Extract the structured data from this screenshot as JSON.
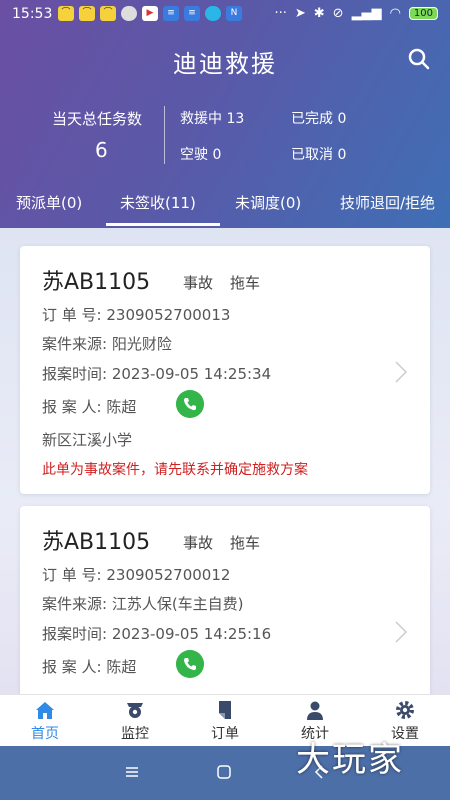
{
  "status_bar": {
    "time": "15:53",
    "battery": "100",
    "icons": [
      "notification-icons",
      "more-dots",
      "location-icon",
      "bluetooth-icon",
      "mute-icon",
      "signal-icon",
      "wifi-icon",
      "battery-icon"
    ]
  },
  "app": {
    "title": "迪迪救援"
  },
  "stats": {
    "total_label": "当天总任务数",
    "total_value": "6",
    "rescuing": "救援中 13",
    "completed": "已完成 0",
    "empty_driving": "空驶 0",
    "cancelled": "已取消 0"
  },
  "tabs": [
    {
      "label": "预派单(0)"
    },
    {
      "label": "未签收(11)",
      "active": true
    },
    {
      "label": "未调度(0)"
    },
    {
      "label": "技师退回/拒绝"
    }
  ],
  "orders": [
    {
      "plate": "苏AB1105",
      "type": "事故",
      "service": "拖车",
      "order_no": "订 单 号: 2309052700013",
      "source": "案件来源: 阳光财险",
      "report_time": "报案时间: 2023-09-05 14:25:34",
      "reporter": "报 案 人: 陈超",
      "address": "新区江溪小学",
      "warning": "此单为事故案件，请先联系并确定施救方案"
    },
    {
      "plate": "苏AB1105",
      "type": "事故",
      "service": "拖车",
      "order_no": "订 单 号: 2309052700012",
      "source": "案件来源: 江苏人保(车主自费)",
      "report_time": "报案时间: 2023-09-05 14:25:16",
      "reporter": "报 案 人: 陈超"
    }
  ],
  "bottom_nav": [
    {
      "label": "首页",
      "icon": "home-icon",
      "active": true
    },
    {
      "label": "监控",
      "icon": "camera-icon"
    },
    {
      "label": "订单",
      "icon": "document-icon"
    },
    {
      "label": "统计",
      "icon": "person-icon"
    },
    {
      "label": "设置",
      "icon": "gear-icon"
    }
  ],
  "watermark": "大玩家",
  "colors": {
    "accent": "#2f8be6",
    "warning": "#d02020",
    "phone": "#34b54a",
    "header_start": "#6a4fa3",
    "header_end": "#3f6fb5"
  }
}
